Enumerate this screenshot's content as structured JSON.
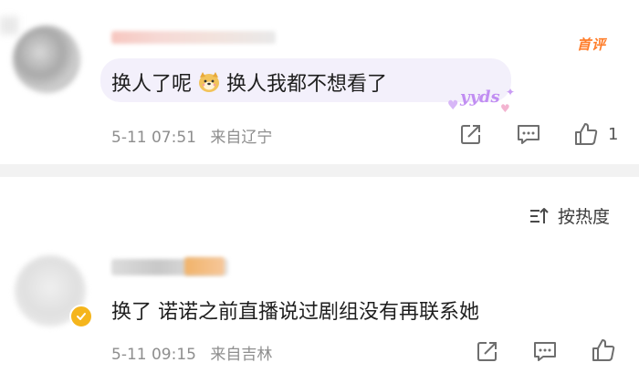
{
  "comments": [
    {
      "badge": "首评",
      "text_part1": "换人了呢",
      "emoji": "doge-emoji",
      "text_part2": "换人我都不想看了",
      "sticker": "yyds",
      "time": "5-11 07:51",
      "location": "来自辽宁",
      "like_count": "1",
      "bubble_color": "#f3f0fb"
    },
    {
      "text": "换了 诺诺之前直播说过剧组没有再联系她",
      "time": "5-11 09:15",
      "location": "来自吉林",
      "verified_color": "#f5b51c"
    }
  ],
  "sort": {
    "label": "按热度",
    "icon": "sort-icon"
  },
  "colors": {
    "accent_orange": "#ff7d2a",
    "meta_gray": "#8e8e8e",
    "divider": "#f2f2f2"
  }
}
